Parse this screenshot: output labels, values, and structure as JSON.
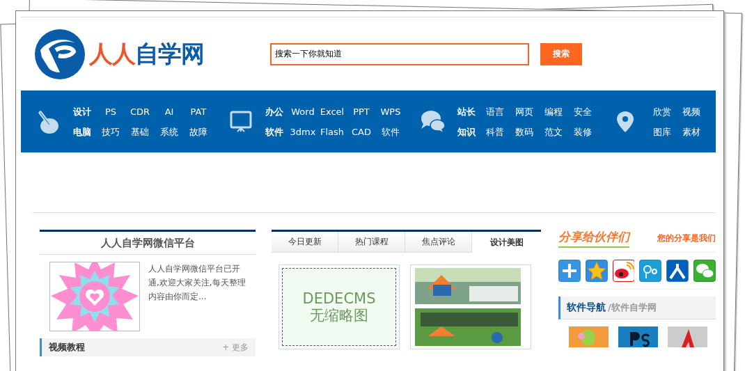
{
  "logo": {
    "part_1": "人人",
    "part_2": "自学网"
  },
  "search": {
    "value": "搜索一下你就知道",
    "button": "搜索"
  },
  "nav": [
    {
      "heading": [
        "设计",
        "电脑"
      ],
      "rows": [
        [
          "PS",
          "CDR",
          "AI",
          "PAT"
        ],
        [
          "技巧",
          "基础",
          "系统",
          "故障"
        ]
      ]
    },
    {
      "heading": [
        "办公",
        "软件"
      ],
      "rows": [
        [
          "Word",
          "Excel",
          "PPT",
          "WPS"
        ],
        [
          "3dmx",
          "Flash",
          "CAD",
          "软件"
        ]
      ]
    },
    {
      "heading": [
        "站长",
        "知识"
      ],
      "rows": [
        [
          "语言",
          "网页",
          "编程",
          "安全"
        ],
        [
          "科普",
          "数码",
          "范文",
          "装修"
        ]
      ]
    },
    {
      "rows": [
        [
          "欣赏",
          "视频"
        ],
        [
          "图库",
          "素材"
        ]
      ]
    }
  ],
  "wechat": {
    "title": "人人自学网微信平台",
    "text": "人人自学网微信平台已开通,欢迎大家关注,每天整理内容由你而定..."
  },
  "video": {
    "title": "视频教程",
    "more": "+ 更多"
  },
  "tabs": [
    {
      "label": "今日更新",
      "selected": false
    },
    {
      "label": "热门课程",
      "selected": false
    },
    {
      "label": "焦点评论",
      "selected": false
    },
    {
      "label": "设计美图",
      "selected": true
    }
  ],
  "thumbs": [
    {
      "kind": "placeholder",
      "line_1": "DEDECMS",
      "line_2": "无缩略图"
    },
    {
      "kind": "picture"
    }
  ],
  "share": {
    "title": "分享给伙伴们",
    "slogan": "您的分享是我们"
  },
  "software": {
    "title": "软件导航",
    "subtitle": "/软件自学网"
  }
}
